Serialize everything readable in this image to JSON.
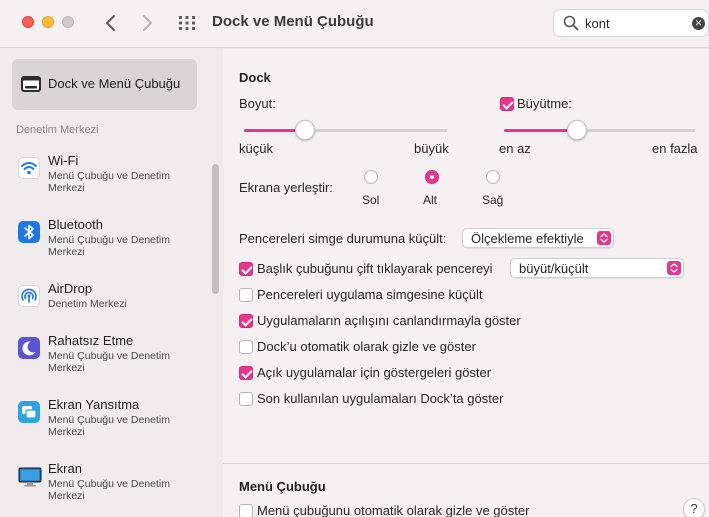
{
  "window": {
    "title": "Dock ve Menü Çubuğu"
  },
  "search": {
    "value": "kont"
  },
  "sidebar": {
    "selected": {
      "label": "Dock ve Menü Çubuğu"
    },
    "section_label": "Denetim Merkezi",
    "items": [
      {
        "name": "Wi-Fi",
        "sub": "Menü Çubuğu ve Denetim Merkezi",
        "icon": "wifi-icon"
      },
      {
        "name": "Bluetooth",
        "sub": "Menü Çubuğu ve Denetim Merkezi",
        "icon": "bluetooth-icon"
      },
      {
        "name": "AirDrop",
        "sub": "Denetim Merkezi",
        "icon": "airdrop-icon"
      },
      {
        "name": "Rahatsız Etme",
        "sub": "Menü Çubuğu ve Denetim Merkezi",
        "icon": "moon-icon"
      },
      {
        "name": "Ekran Yansıtma",
        "sub": "Menü Çubuğu ve Denetim Merkezi",
        "icon": "screen-mirroring-icon"
      },
      {
        "name": "Ekran",
        "sub": "Menü Çubuğu ve Denetim Merkezi",
        "icon": "display-icon"
      }
    ]
  },
  "dock": {
    "heading": "Dock",
    "size": {
      "label": "Boyut:",
      "min_label": "küçük",
      "max_label": "büyük",
      "value": 0.3
    },
    "magnification": {
      "label": "Büyütme:",
      "checked": true,
      "min_label": "en az",
      "max_label": "en fazla",
      "value": 0.38
    },
    "position": {
      "label": "Ekrana yerleştir:",
      "options": [
        {
          "label": "Sol",
          "selected": false
        },
        {
          "label": "Alt",
          "selected": true
        },
        {
          "label": "Sağ",
          "selected": false
        }
      ]
    },
    "minimize": {
      "label": "Pencereleri simge durumuna küçült:",
      "value": "Ölçekleme efektiyle"
    },
    "double_click": {
      "label": "Başlık çubuğunu çift tıklayarak pencereyi",
      "checked": true,
      "value": "büyüt/küçült"
    },
    "options": [
      {
        "label": "Pencereleri uygulama simgesine küçült",
        "checked": false
      },
      {
        "label": "Uygulamaların açılışını canlandırmayla göster",
        "checked": true
      },
      {
        "label": "Dock’u otomatik olarak gizle ve göster",
        "checked": false
      },
      {
        "label": "Açık uygulamalar için göstergeleri göster",
        "checked": true
      },
      {
        "label": "Son kullanılan uygulamaları Dock’ta göster",
        "checked": false
      }
    ]
  },
  "menubar": {
    "heading": "Menü Çubuğu",
    "autohide": {
      "label": "Menü çubuğunu otomatik olarak gizle ve göster",
      "checked": false
    }
  },
  "help": {
    "label": "?"
  },
  "colors": {
    "accent": "#e8378b"
  }
}
